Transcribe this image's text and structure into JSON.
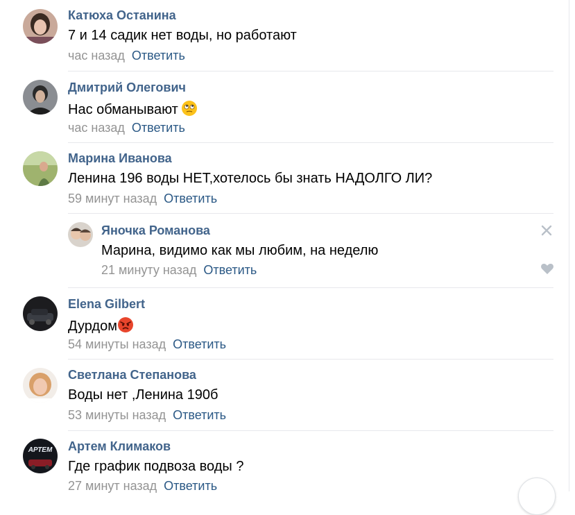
{
  "comments": [
    {
      "author": "Катюха Останина",
      "text": "7 и 14 садик нет воды, но работают",
      "time": "час назад",
      "reply": "Ответить"
    },
    {
      "author": "Дмитрий Олегович",
      "text": "Нас обманывают",
      "time": "час назад",
      "reply": "Ответить",
      "emoji": "rolling-eyes-emoji"
    },
    {
      "author": "Марина Иванова",
      "text": "Ленина 196 воды НЕТ,хотелось бы знать НАДОЛГО ЛИ?",
      "time": "59 минут назад",
      "reply": "Ответить"
    },
    {
      "author": "Яночка Романова",
      "text": "Марина, видимо как мы любим, на неделю",
      "time": "21 минуту назад",
      "reply": "Ответить"
    },
    {
      "author": "Elena Gilbert",
      "text": "Дурдом",
      "time": "54 минуты назад",
      "reply": "Ответить",
      "emoji": "angry-face-emoji"
    },
    {
      "author": "Светлана Степанова",
      "text": "Воды нет ,Ленина 190б",
      "time": "53 минуты назад",
      "reply": "Ответить"
    },
    {
      "author": "Артем Климаков",
      "text": "Где график подвоза воды ?",
      "time": "27 минут назад",
      "reply": "Ответить",
      "avatar_text": "АРТЕМ"
    }
  ],
  "colors": {
    "author": "#42648b",
    "link": "#2a5885",
    "meta": "#939393",
    "divider": "#e7e8ec"
  },
  "icons": [
    "close-icon",
    "heart-icon",
    "scroll-down-icon"
  ]
}
